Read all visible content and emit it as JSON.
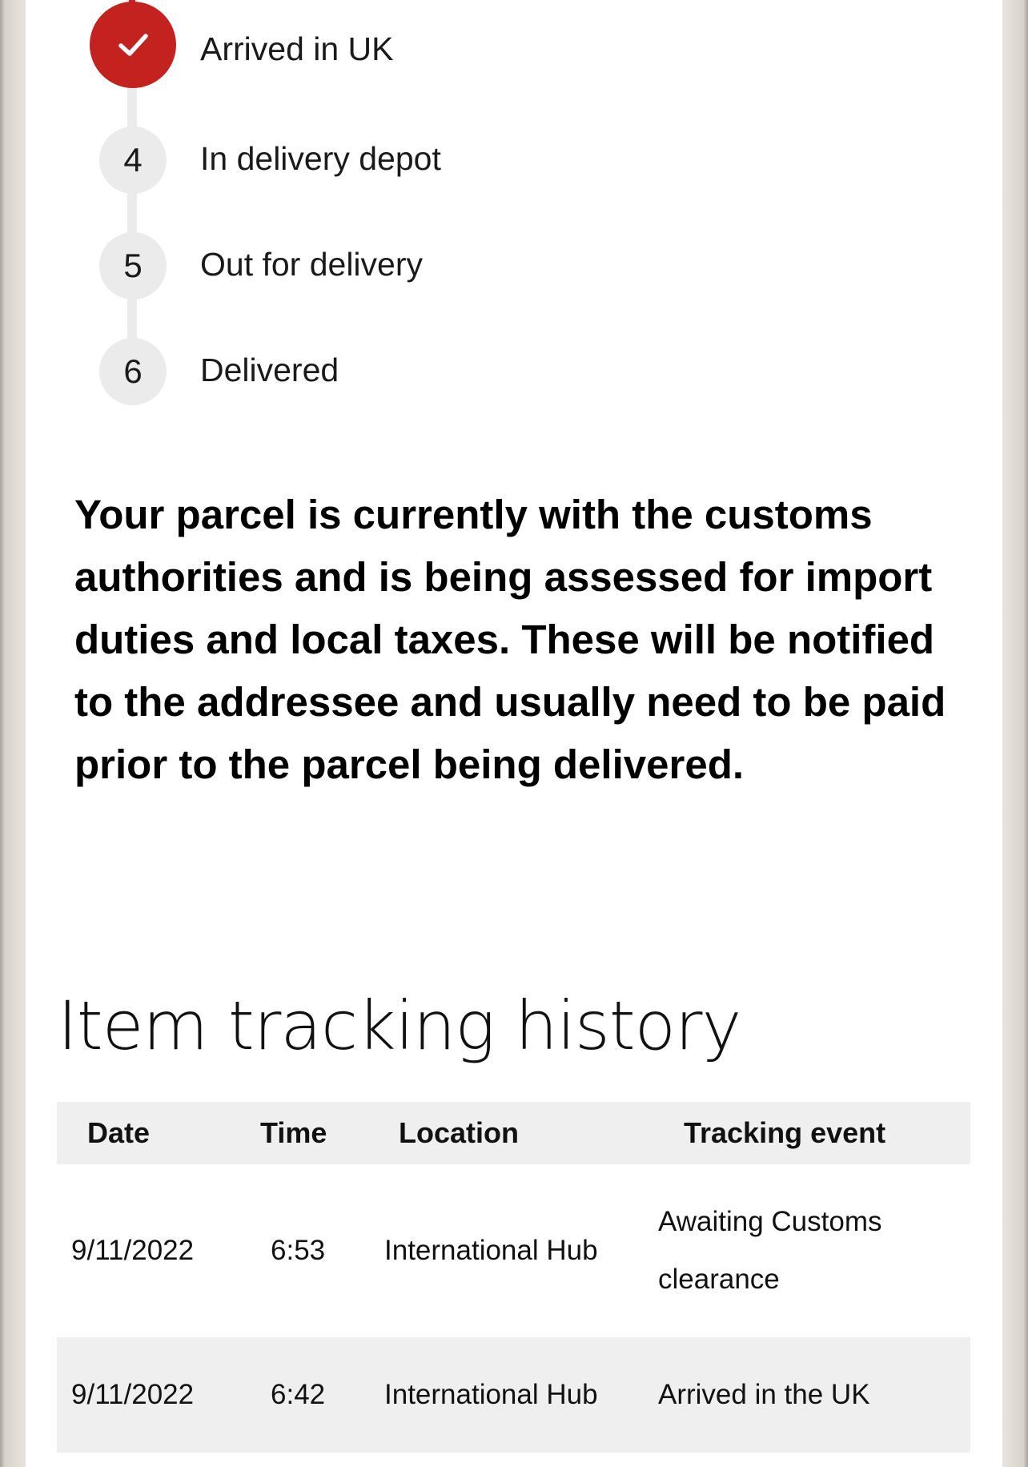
{
  "tracker": {
    "steps": [
      {
        "marker": "",
        "label": "Arrived in UK",
        "status": "done"
      },
      {
        "marker": "4",
        "label": "In delivery depot",
        "status": "pending"
      },
      {
        "marker": "5",
        "label": "Out for delivery",
        "status": "pending"
      },
      {
        "marker": "6",
        "label": "Delivered",
        "status": "pending"
      }
    ],
    "colors": {
      "done": "#c4221f",
      "pending": "#ebebeb"
    }
  },
  "status_message": "Your parcel is currently with the customs authorities and is being assessed for import duties and local taxes. These will be notified to the addressee and usually need to be paid prior to the parcel being delivered.",
  "history": {
    "title": "Item tracking history",
    "columns": [
      "Date",
      "Time",
      "Location",
      "Tracking event"
    ],
    "rows": [
      {
        "date": "9/11/2022",
        "time": "6:53",
        "location": "International Hub",
        "event": "Awaiting Customs clearance"
      },
      {
        "date": "9/11/2022",
        "time": "6:42",
        "location": "International Hub",
        "event": "Arrived in the UK"
      }
    ]
  }
}
